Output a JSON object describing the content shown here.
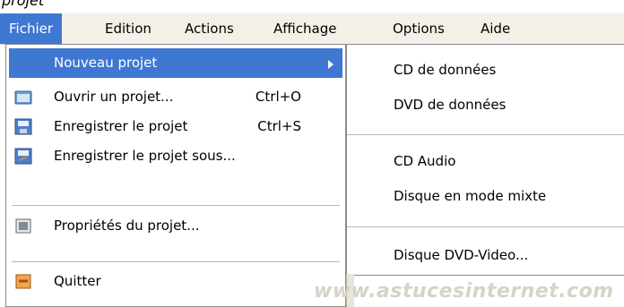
{
  "top_fragment": "projet",
  "menubar": {
    "items": [
      {
        "label": "Fichier",
        "active": true
      },
      {
        "label": "Edition"
      },
      {
        "label": "Actions"
      },
      {
        "label": "Affichage"
      },
      {
        "label": "Options"
      },
      {
        "label": "Aide"
      }
    ]
  },
  "file_menu": {
    "items": [
      {
        "label": "Nouveau projet",
        "icon": "",
        "has_submenu": true
      },
      {
        "label": "Ouvrir un projet...",
        "shortcut": "Ctrl+O",
        "icon": "folder-open-icon"
      },
      {
        "label": "Enregistrer le projet",
        "shortcut": "Ctrl+S",
        "icon": "save-icon"
      },
      {
        "label": "Enregistrer le projet sous...",
        "icon": "save-as-icon"
      },
      {
        "label": "Propriétés du projet...",
        "icon": "properties-icon"
      },
      {
        "label": "Quitter",
        "icon": "exit-icon"
      }
    ]
  },
  "submenu": {
    "items": [
      {
        "label": "CD de données"
      },
      {
        "label": "DVD de données"
      },
      {
        "label": "CD Audio"
      },
      {
        "label": "Disque en mode mixte"
      },
      {
        "label": "Disque DVD-Video..."
      }
    ]
  },
  "watermark": "www.astucesinternet.com",
  "colors": {
    "menubar_bg": "#f3f1e7",
    "highlight": "#3f78d3",
    "menu_bg": "#ffffff",
    "separator": "#b8b8b8"
  }
}
